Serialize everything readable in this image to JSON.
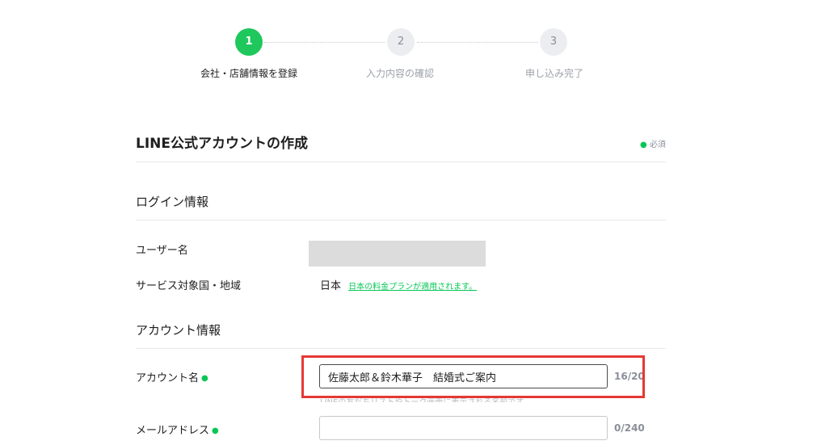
{
  "stepper": {
    "steps": [
      {
        "number": "1",
        "label": "会社・店舗情報を登録",
        "state": "active"
      },
      {
        "number": "2",
        "label": "入力内容の確認",
        "state": "inactive"
      },
      {
        "number": "3",
        "label": "申し込み完了",
        "state": "inactive"
      }
    ]
  },
  "header": {
    "title": "LINE公式アカウントの作成",
    "required_legend": "必須"
  },
  "login_section": {
    "title": "ログイン情報",
    "username_label": "ユーザー名",
    "region_label": "サービス対象国・地域",
    "region_value": "日本",
    "region_link": "日本の料金プランが適用されます。"
  },
  "account_section": {
    "title": "アカウント情報",
    "account_name": {
      "label": "アカウント名",
      "value": "佐藤太郎＆鈴木華子　結婚式ご案内",
      "counter": "16/20",
      "help": "LINEの友だちリストやトーク画面に表示される名前です。"
    },
    "email": {
      "label": "メールアドレス",
      "value": "",
      "counter": "0/240"
    }
  },
  "colors": {
    "accent_green": "#06c755",
    "highlight_red": "#e53935"
  }
}
